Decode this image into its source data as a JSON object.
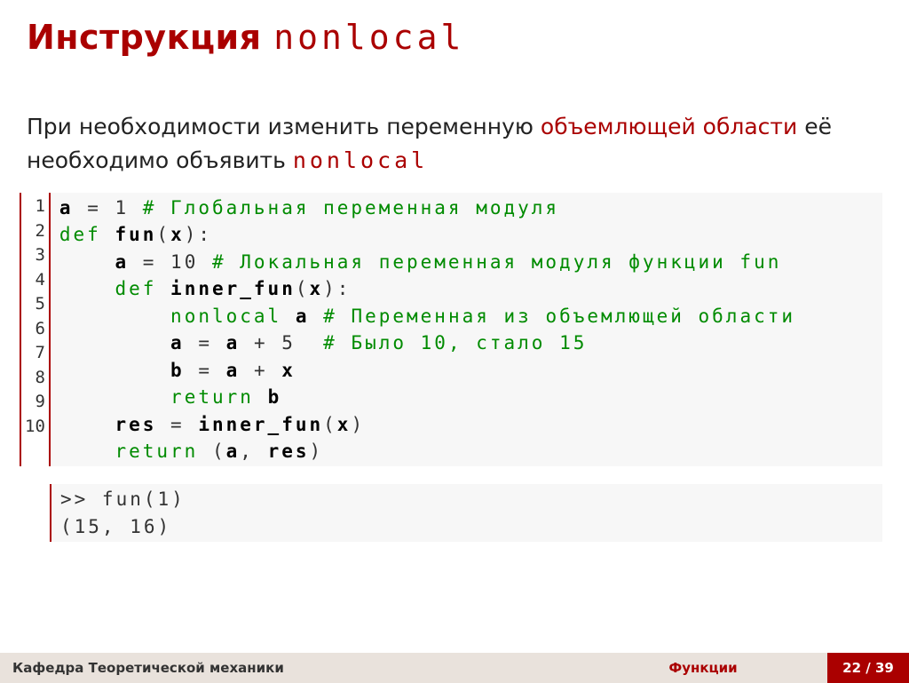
{
  "title_prefix": "Инструкция ",
  "title_mono": "nonlocal",
  "paragraph_pre": "При необходимости изменить переменную ",
  "paragraph_hl": "объемлющей области",
  "paragraph_mid": " её необходимо объявить ",
  "paragraph_mono": "nonlocal",
  "code": {
    "lines": [
      {
        "n": "1",
        "seg": [
          {
            "c": "bold",
            "t": "a"
          },
          {
            "c": "",
            "t": " = 1 "
          },
          {
            "c": "cm",
            "t": "# Глобальная переменная модуля"
          }
        ]
      },
      {
        "n": "2",
        "seg": [
          {
            "c": "kw",
            "t": "def "
          },
          {
            "c": "bold",
            "t": "fun"
          },
          {
            "c": "",
            "t": "("
          },
          {
            "c": "bold",
            "t": "x"
          },
          {
            "c": "",
            "t": "):"
          }
        ]
      },
      {
        "n": "3",
        "seg": [
          {
            "c": "",
            "t": "    "
          },
          {
            "c": "bold",
            "t": "a"
          },
          {
            "c": "",
            "t": " = 10 "
          },
          {
            "c": "cm",
            "t": "# Локальная переменная модуля функции fun"
          }
        ]
      },
      {
        "n": "4",
        "seg": [
          {
            "c": "",
            "t": "    "
          },
          {
            "c": "kw",
            "t": "def "
          },
          {
            "c": "bold",
            "t": "inner_fun"
          },
          {
            "c": "",
            "t": "("
          },
          {
            "c": "bold",
            "t": "x"
          },
          {
            "c": "",
            "t": "):"
          }
        ]
      },
      {
        "n": "5",
        "seg": [
          {
            "c": "",
            "t": "        "
          },
          {
            "c": "kw",
            "t": "nonlocal "
          },
          {
            "c": "bold",
            "t": "a"
          },
          {
            "c": "",
            "t": " "
          },
          {
            "c": "cm",
            "t": "# Переменная из объемлющей области"
          }
        ]
      },
      {
        "n": "6",
        "seg": [
          {
            "c": "",
            "t": "        "
          },
          {
            "c": "bold",
            "t": "a"
          },
          {
            "c": "",
            "t": " = "
          },
          {
            "c": "bold",
            "t": "a"
          },
          {
            "c": "",
            "t": " + 5  "
          },
          {
            "c": "cm",
            "t": "# Было 10, стало 15"
          }
        ]
      },
      {
        "n": "7",
        "seg": [
          {
            "c": "",
            "t": "        "
          },
          {
            "c": "bold",
            "t": "b"
          },
          {
            "c": "",
            "t": " = "
          },
          {
            "c": "bold",
            "t": "a"
          },
          {
            "c": "",
            "t": " + "
          },
          {
            "c": "bold",
            "t": "x"
          }
        ]
      },
      {
        "n": "8",
        "seg": [
          {
            "c": "",
            "t": "        "
          },
          {
            "c": "kw",
            "t": "return "
          },
          {
            "c": "bold",
            "t": "b"
          }
        ]
      },
      {
        "n": "9",
        "seg": [
          {
            "c": "",
            "t": "    "
          },
          {
            "c": "bold",
            "t": "res"
          },
          {
            "c": "",
            "t": " = "
          },
          {
            "c": "bold",
            "t": "inner_fun"
          },
          {
            "c": "",
            "t": "("
          },
          {
            "c": "bold",
            "t": "x"
          },
          {
            "c": "",
            "t": ")"
          }
        ]
      },
      {
        "n": "10",
        "seg": [
          {
            "c": "",
            "t": "    "
          },
          {
            "c": "kw",
            "t": "return "
          },
          {
            "c": "",
            "t": "("
          },
          {
            "c": "bold",
            "t": "a"
          },
          {
            "c": "",
            "t": ", "
          },
          {
            "c": "bold",
            "t": "res"
          },
          {
            "c": "",
            "t": ")"
          }
        ]
      }
    ]
  },
  "output_lines": [
    ">> fun(1)",
    "(15, 16)"
  ],
  "footer": {
    "left": "Кафедра Теоретической механики",
    "mid": "Функции",
    "right": "22 / 39"
  }
}
